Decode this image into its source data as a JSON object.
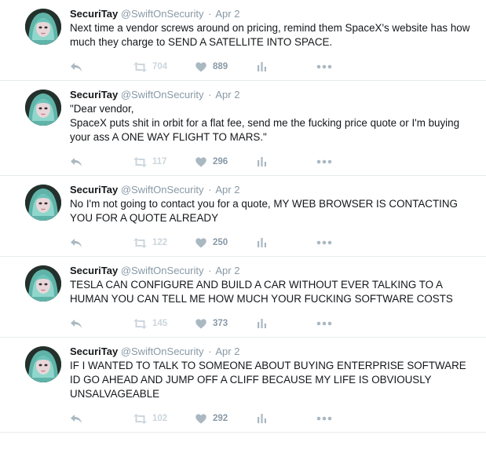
{
  "tweets": [
    {
      "name": "SecuriTay",
      "handle": "@SwiftOnSecurity",
      "sep": "·",
      "date": "Apr 2",
      "text": "Next time a vendor screws around on  pricing, remind them SpaceX's website has how much they charge to SEND A SATELLITE INTO SPACE.",
      "retweets": "704",
      "likes": "889"
    },
    {
      "name": "SecuriTay",
      "handle": "@SwiftOnSecurity",
      "sep": "·",
      "date": "Apr 2",
      "text": "\"Dear vendor,\nSpaceX puts shit in orbit for a flat fee, send me the fucking price quote or I'm buying your ass A ONE WAY FLIGHT TO MARS.\"",
      "retweets": "117",
      "likes": "296"
    },
    {
      "name": "SecuriTay",
      "handle": "@SwiftOnSecurity",
      "sep": "·",
      "date": "Apr 2",
      "text": "No I'm not going to contact you for a quote, MY WEB BROWSER IS CONTACTING YOU FOR A QUOTE ALREADY",
      "retweets": "122",
      "likes": "250"
    },
    {
      "name": "SecuriTay",
      "handle": "@SwiftOnSecurity",
      "sep": "·",
      "date": "Apr 2",
      "text": "TESLA CAN CONFIGURE AND BUILD A CAR WITHOUT EVER TALKING TO A HUMAN YOU CAN TELL ME HOW MUCH YOUR FUCKING SOFTWARE COSTS",
      "retweets": "145",
      "likes": "373"
    },
    {
      "name": "SecuriTay",
      "handle": "@SwiftOnSecurity",
      "sep": "·",
      "date": "Apr 2",
      "text": "IF I WANTED TO TALK TO SOMEONE ABOUT BUYING ENTERPRISE SOFTWARE ID GO AHEAD AND JUMP OFF A CLIFF BECAUSE MY LIFE IS OBVIOUSLY UNSALVAGEABLE",
      "retweets": "102",
      "likes": "292"
    }
  ],
  "icons": {
    "reply": "reply-icon",
    "retweet": "retweet-icon",
    "like": "heart-icon",
    "analytics": "analytics-icon",
    "more": "more-icon"
  },
  "colors": {
    "text": "#14171a",
    "muted": "#8899a6",
    "icon": "#aab8c2",
    "border": "#e6ecf0"
  }
}
